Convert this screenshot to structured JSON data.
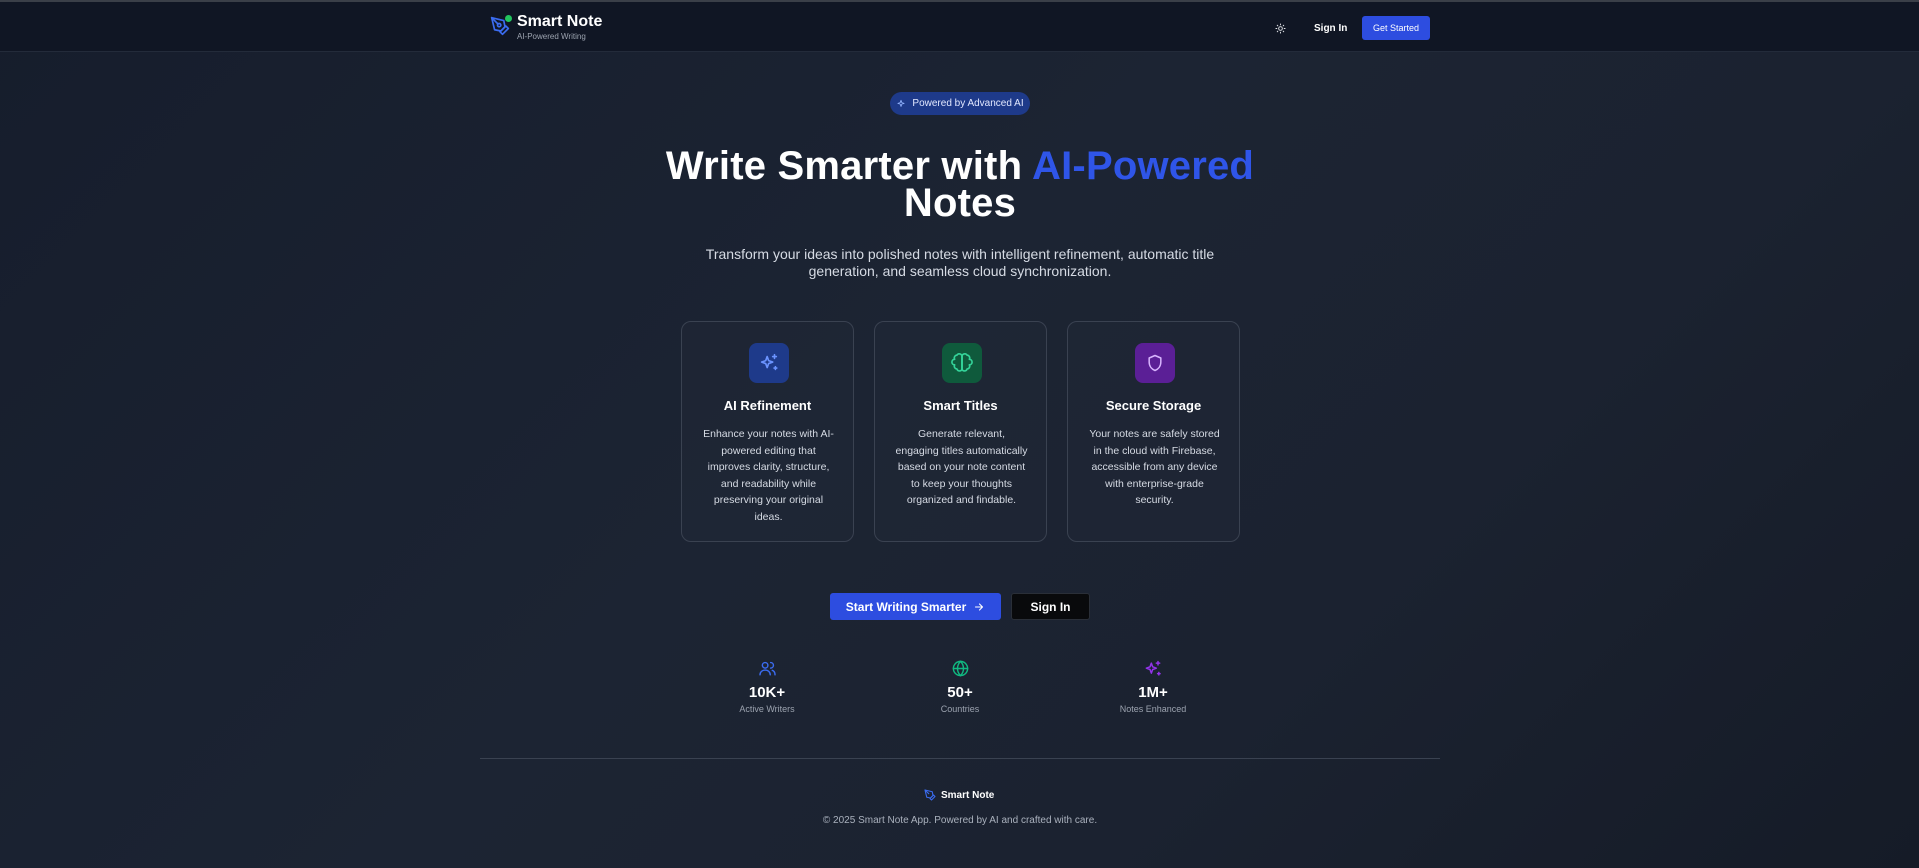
{
  "header": {
    "app_name": "Smart Note",
    "tagline": "AI-Powered Writing",
    "theme_icon": "sun-icon",
    "sign_in_label": "Sign In",
    "get_started_label": "Get Started"
  },
  "hero": {
    "badge": "Powered by Advanced AI",
    "title_part1": "Write Smarter with ",
    "title_accent": "AI-Powered",
    "title_part2": " Notes",
    "subtitle": "Transform your ideas into polished notes with intelligent refinement, automatic title generation, and seamless cloud synchronization."
  },
  "features": [
    {
      "icon": "sparkles-icon",
      "title": "AI Refinement",
      "description": "Enhance your notes with AI-powered editing that improves clarity, structure, and readability while preserving your original ideas."
    },
    {
      "icon": "brain-icon",
      "title": "Smart Titles",
      "description": "Generate relevant, engaging titles automatically based on your note content to keep your thoughts organized and findable."
    },
    {
      "icon": "shield-icon",
      "title": "Secure Storage",
      "description": "Your notes are safely stored in the cloud with Firebase, accessible from any device with enterprise-grade security."
    }
  ],
  "cta": {
    "primary_label": "Start Writing Smarter",
    "secondary_label": "Sign In"
  },
  "stats": [
    {
      "icon": "users-icon",
      "value": "10K+",
      "label": "Active Writers"
    },
    {
      "icon": "globe-icon",
      "value": "50+",
      "label": "Countries"
    },
    {
      "icon": "sparkles-icon",
      "value": "1M+",
      "label": "Notes Enhanced"
    }
  ],
  "footer": {
    "brand": "Smart Note",
    "copyright": "© 2025 Smart Note App. Powered by AI and crafted with care."
  },
  "colors": {
    "accent": "#2f55e8",
    "primary_button": "#2d4de0",
    "green": "#22c55e",
    "purple": "#9333ea",
    "background": "#1c2433"
  }
}
